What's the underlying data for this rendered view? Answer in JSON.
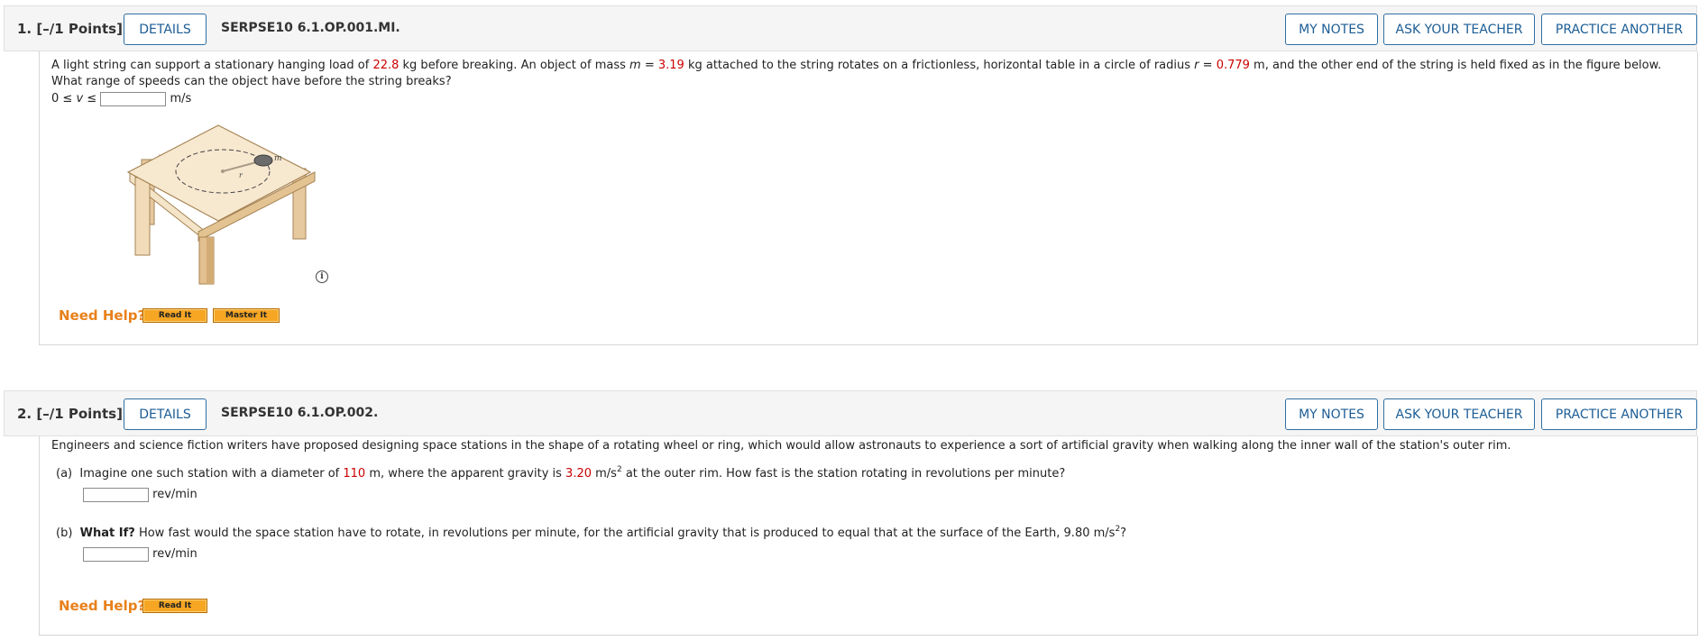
{
  "common": {
    "details_label": "DETAILS",
    "my_notes_label": "MY NOTES",
    "ask_teacher_label": "ASK YOUR TEACHER",
    "practice_label": "PRACTICE ANOTHER",
    "need_help_label": "Need Help?",
    "read_it_label": "Read It",
    "master_it_label": "Master It"
  },
  "q1": {
    "number": "1.  [–/1 Points]",
    "code": "SERPSE10 6.1.OP.001.MI.",
    "text_a": "A light string can support a stationary hanging load of ",
    "load_value": "22.8",
    "text_b": " kg before breaking. An object of mass ",
    "m_symbol": "m",
    "eq1": " = ",
    "mass_value": "3.19",
    "text_c": " kg attached to the string rotates on a frictionless, horizontal table in a circle of radius ",
    "r_symbol": "r",
    "eq2": " = ",
    "radius_value": "0.779",
    "text_d": " m, and the other end of the string is held fixed as in the figure below. What range of speeds can the object have before the string breaks?",
    "range_prefix": "0 ≤ ",
    "v_symbol": "v",
    "range_suffix": " ≤ ",
    "unit": "m/s",
    "figure_m_label": "m",
    "figure_r_label": "r",
    "info_glyph": "i"
  },
  "q2": {
    "number": "2.  [–/1 Points]",
    "code": "SERPSE10 6.1.OP.002.",
    "intro": "Engineers and science fiction writers have proposed designing space stations in the shape of a rotating wheel or ring, which would allow astronauts to experience a sort of artificial gravity when walking along the inner wall of the station's outer rim.",
    "a_label": "(a)",
    "a_text_1": "Imagine one such station with a diameter of ",
    "diameter_value": "110",
    "a_text_2": " m, where the apparent gravity is ",
    "gravity_value": "3.20",
    "a_text_3": " m/s",
    "a_text_4": " at the outer rim. How fast is the station rotating in revolutions per minute?",
    "sup2": "2",
    "b_label": "(b)",
    "b_bold": "What If?",
    "b_text_1": " How fast would the space station have to rotate, in revolutions per minute, for the artificial gravity that is produced to equal that at the surface of the Earth, 9.80 m/s",
    "b_text_2": "?",
    "unit": "rev/min"
  }
}
